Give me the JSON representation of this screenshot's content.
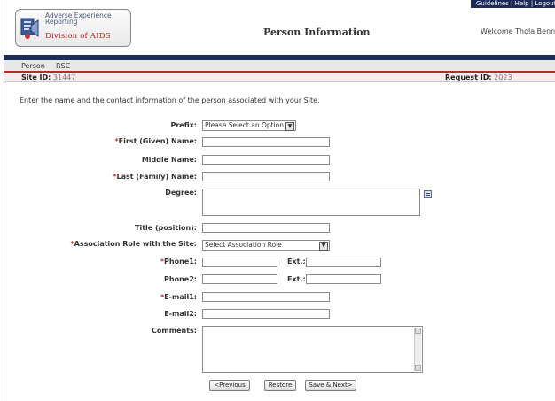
{
  "header": {
    "top_links": "Guidelines | Help | Logout",
    "logo": {
      "line1": "Adverse Experience",
      "line2": "Reporting",
      "line3": "Division of AIDS"
    },
    "page_title": "Person Information",
    "welcome": "Welcome Thola Bennie"
  },
  "tabs": [
    "Person",
    "RSC"
  ],
  "info": {
    "site_label": "Site ID:",
    "site_value": "31447",
    "request_label": "Request ID:",
    "request_value": "2023"
  },
  "intro": "Enter the name and the contact information of the person associated with your Site.",
  "form": {
    "prefix_label": "Prefix:",
    "prefix_value": "Please Select an Option",
    "first_label": "First (Given) Name:",
    "middle_label": "Middle Name:",
    "last_label": "Last (Family) Name:",
    "degree_label": "Degree:",
    "title_label": "Title (position):",
    "role_label": "Association Role with the Site:",
    "role_value": "Select Association Role",
    "phone1_label": "Phone1:",
    "phone2_label": "Phone2:",
    "ext_label": "Ext.:",
    "email1_label": "E-mail1:",
    "email2_label": "E-mail2:",
    "comments_label": "Comments:",
    "required_mark": "*"
  },
  "buttons": {
    "previous": "<Previous",
    "restore": "Restore",
    "save_next": "Save & Next>"
  },
  "colors": {
    "navy": "#1c2f5c",
    "accent_red": "#b32b2b",
    "required": "#c0392b"
  }
}
